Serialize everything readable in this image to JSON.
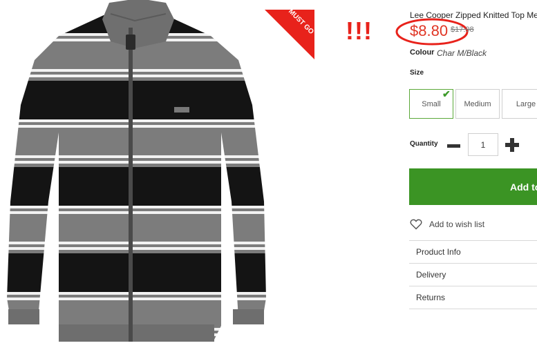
{
  "product": {
    "title": "Lee Cooper Zipped Knitted Top Mens",
    "price": "$8.80",
    "old_price": "$17.98",
    "colour_label": "Colour",
    "colour_value": "Char M/Black",
    "size_label": "Size",
    "sizes": [
      "Small",
      "Medium",
      "Large"
    ],
    "selected_size": "Small",
    "quantity_label": "Quantity",
    "quantity_value": "1",
    "add_to_bag_label": "Add to Bag",
    "wishlist_label": "Add to wish list"
  },
  "badge": {
    "must_go": "MUST GO",
    "exclaim": "!!!"
  },
  "accordion": [
    "Product Info",
    "Delivery",
    "Returns"
  ],
  "colors": {
    "accent_green": "#3b9424",
    "price_red": "#e03524",
    "ribbon_red": "#e8221b"
  }
}
